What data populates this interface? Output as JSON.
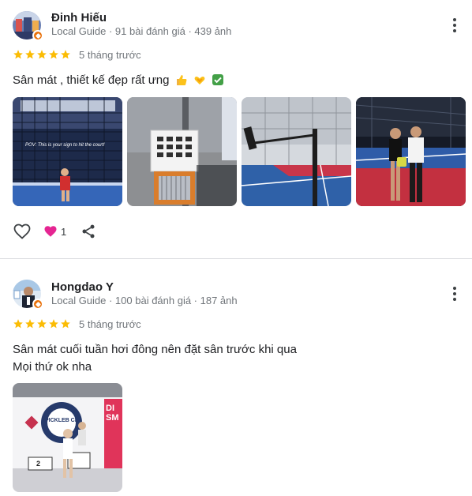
{
  "reviews": [
    {
      "author": "Đinh Hiếu",
      "meta": "Local Guide · 91 bài đánh giá · 439 ảnh",
      "rating": 5,
      "date": "5 tháng trước",
      "text": "Sân mát , thiết kế đẹp rất ưng",
      "photo_overlay_text": "POV: This is your sign to hit the court!",
      "likes": "1"
    },
    {
      "author": "Hongdao Y",
      "meta": "Local Guide · 100 bài đánh giá · 187 ảnh",
      "rating": 5,
      "date": "5 tháng trước",
      "text_line1": "Sân mát cuối tuần hơi đông nên đặt sân trước khi qua",
      "text_line2": "Mọi thứ ok nha",
      "photo_banner_text": "PICKLEB CL",
      "photo_sign_text": "DI SM",
      "photo_podium_number": "2"
    }
  ],
  "colors": {
    "star": "#fbbc04",
    "badge": "#e8710a",
    "heart": "#e52592"
  },
  "icons": [
    "like-heart-icon",
    "love-reaction-icon",
    "share-icon",
    "more-vert-icon",
    "star-icon",
    "local-guide-badge-icon"
  ]
}
